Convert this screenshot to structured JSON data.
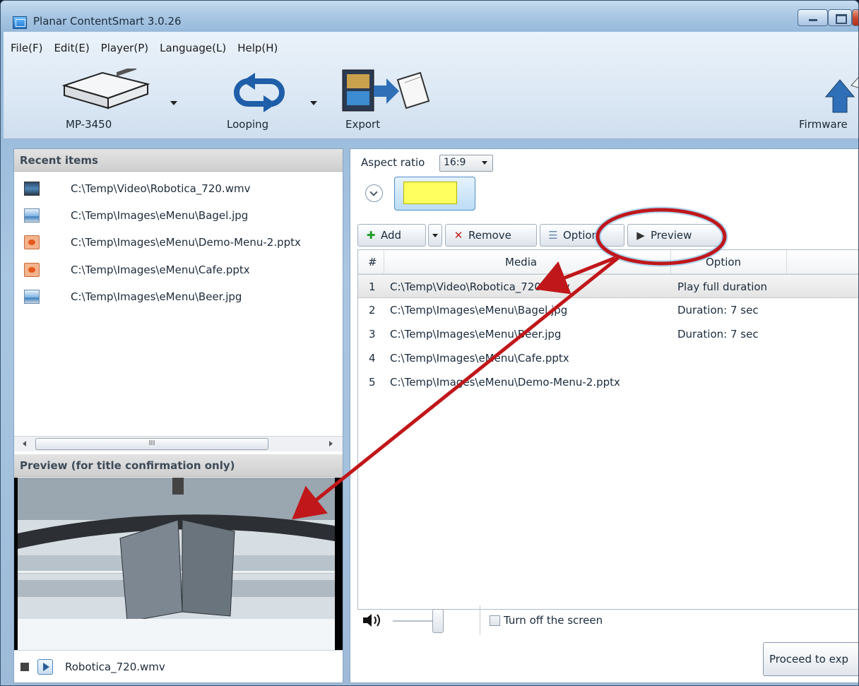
{
  "window": {
    "title": "Planar ContentSmart 3.0.26"
  },
  "menu": [
    "File(F)",
    "Edit(E)",
    "Player(P)",
    "Language(L)",
    "Help(H)"
  ],
  "toolbar": {
    "player": "MP-3450",
    "looping": "Looping",
    "export": "Export",
    "firmware": "Firmware"
  },
  "recent": {
    "header": "Recent items",
    "items": [
      {
        "path": "C:\\Temp\\Video\\Robotica_720.wmv",
        "icon": "video-file-icon"
      },
      {
        "path": "C:\\Temp\\Images\\eMenu\\Bagel.jpg",
        "icon": "image-file-icon"
      },
      {
        "path": "C:\\Temp\\Images\\eMenu\\Demo-Menu-2.pptx",
        "icon": "pptx-file-icon"
      },
      {
        "path": "C:\\Temp\\Images\\eMenu\\Cafe.pptx",
        "icon": "pptx-file-icon"
      },
      {
        "path": "C:\\Temp\\Images\\eMenu\\Beer.jpg",
        "icon": "image-file-icon"
      }
    ],
    "scroll_grip": "III"
  },
  "preview": {
    "header": "Preview (for title confirmation only)",
    "file": "Robotica_720.wmv"
  },
  "content": {
    "aspect_label": "Aspect ratio",
    "aspect_value": "16:9",
    "buttons": {
      "add": "Add",
      "remove": "Remove",
      "option": "Option",
      "preview": "Preview"
    },
    "columns": {
      "num": "#",
      "media": "Media",
      "option": "Option"
    },
    "rows": [
      {
        "num": "1",
        "media": "C:\\Temp\\Video\\Robotica_720.wmv",
        "option": "Play full duration",
        "selected": true
      },
      {
        "num": "2",
        "media": "C:\\Temp\\Images\\eMenu\\Bagel.jpg",
        "option": "Duration: 7 sec"
      },
      {
        "num": "3",
        "media": "C:\\Temp\\Images\\eMenu\\Beer.jpg",
        "option": "Duration: 7 sec"
      },
      {
        "num": "4",
        "media": "C:\\Temp\\Images\\eMenu\\Cafe.pptx",
        "option": ""
      },
      {
        "num": "5",
        "media": "C:\\Temp\\Images\\eMenu\\Demo-Menu-2.pptx",
        "option": ""
      }
    ],
    "turn_off_label": "Turn off the screen",
    "turn_off_checked": false,
    "proceed_label": "Proceed to exp"
  },
  "colors": {
    "annotation": "#c0171a",
    "selection_bg": "#e6e6e6",
    "thumb_yellow": "#ffff60"
  }
}
